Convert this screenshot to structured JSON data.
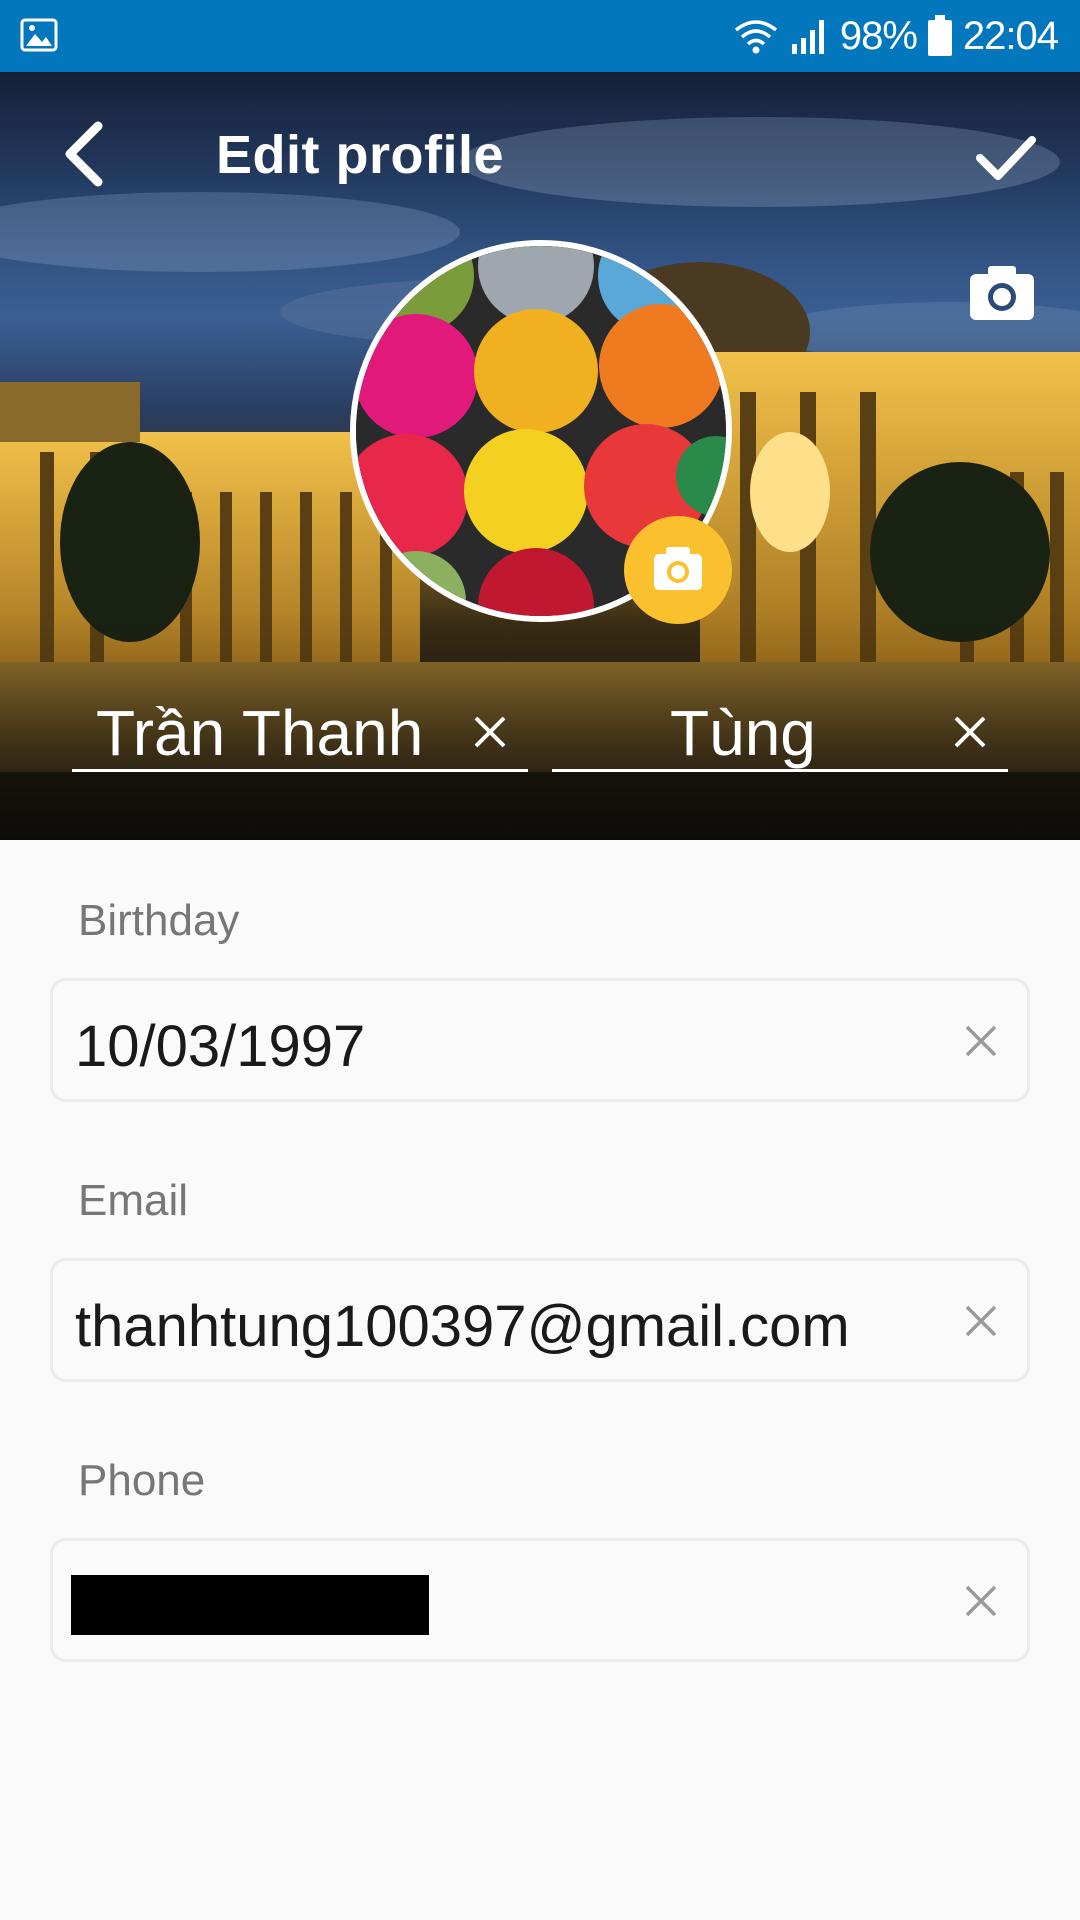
{
  "status_bar": {
    "battery": "98%",
    "time": "22:04",
    "icons": [
      "gallery-icon",
      "wifi-icon",
      "signal-icon",
      "battery-icon"
    ]
  },
  "header": {
    "title": "Edit profile",
    "back_icon": "chevron-left-icon",
    "confirm_icon": "check-icon",
    "cover_camera_icon": "camera-icon",
    "avatar_camera_icon": "camera-icon"
  },
  "name": {
    "first_name": "Trần Thanh",
    "last_name": "Tùng"
  },
  "form": {
    "birthday": {
      "label": "Birthday",
      "value": "10/03/1997"
    },
    "email": {
      "label": "Email",
      "value": "thanhtung100397@gmail.com"
    },
    "phone": {
      "label": "Phone",
      "value": ""
    }
  },
  "colors": {
    "status_bar": "#0277bd",
    "accent": "#fbc02d",
    "background": "#fafafa"
  }
}
